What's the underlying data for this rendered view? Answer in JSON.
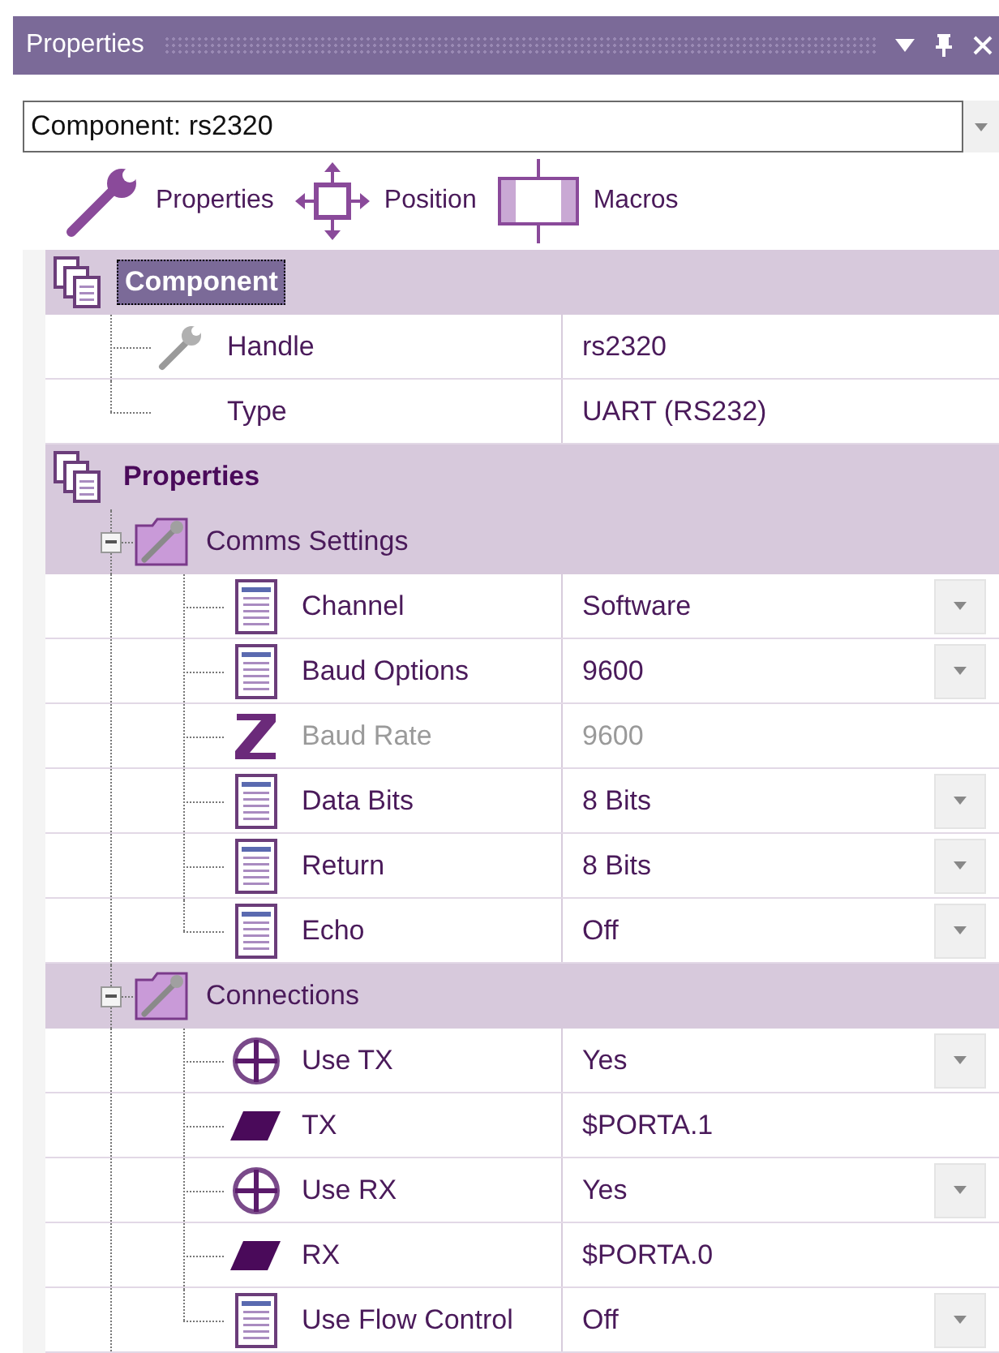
{
  "panel": {
    "title": "Properties"
  },
  "selector": {
    "value": "Component: rs2320"
  },
  "toolbar": [
    {
      "kind": "properties",
      "label": "Properties"
    },
    {
      "kind": "position",
      "label": "Position"
    },
    {
      "kind": "macros",
      "label": "Macros"
    }
  ],
  "sections": [
    {
      "title": "Component",
      "selected": true,
      "rows": [
        {
          "kind": "wrench",
          "label": "Handle",
          "value": "rs2320",
          "dropdown": false,
          "disabled": false
        },
        {
          "kind": "plain",
          "label": "Type",
          "value": "UART (RS232)",
          "dropdown": false,
          "disabled": false
        }
      ]
    },
    {
      "title": "Properties",
      "selected": false,
      "groups": [
        {
          "title": "Comms Settings",
          "expanded": true,
          "rows": [
            {
              "kind": "list",
              "label": "Channel",
              "value": "Software",
              "dropdown": true,
              "disabled": false
            },
            {
              "kind": "list",
              "label": "Baud Options",
              "value": "9600",
              "dropdown": true,
              "disabled": false
            },
            {
              "kind": "z",
              "label": "Baud Rate",
              "value": "9600",
              "dropdown": false,
              "disabled": true
            },
            {
              "kind": "list",
              "label": "Data Bits",
              "value": "8 Bits",
              "dropdown": true,
              "disabled": false
            },
            {
              "kind": "list",
              "label": "Return",
              "value": "8 Bits",
              "dropdown": true,
              "disabled": false
            },
            {
              "kind": "list",
              "label": "Echo",
              "value": "Off",
              "dropdown": true,
              "disabled": false
            }
          ]
        },
        {
          "title": "Connections",
          "expanded": true,
          "rows": [
            {
              "kind": "cross",
              "label": "Use TX",
              "value": "Yes",
              "dropdown": true,
              "disabled": false
            },
            {
              "kind": "pin",
              "label": "TX",
              "value": "$PORTA.1",
              "dropdown": false,
              "disabled": false
            },
            {
              "kind": "cross",
              "label": "Use RX",
              "value": "Yes",
              "dropdown": true,
              "disabled": false
            },
            {
              "kind": "pin",
              "label": "RX",
              "value": "$PORTA.0",
              "dropdown": false,
              "disabled": false
            },
            {
              "kind": "list",
              "label": "Use Flow Control",
              "value": "Off",
              "dropdown": true,
              "disabled": false
            }
          ]
        }
      ]
    }
  ]
}
